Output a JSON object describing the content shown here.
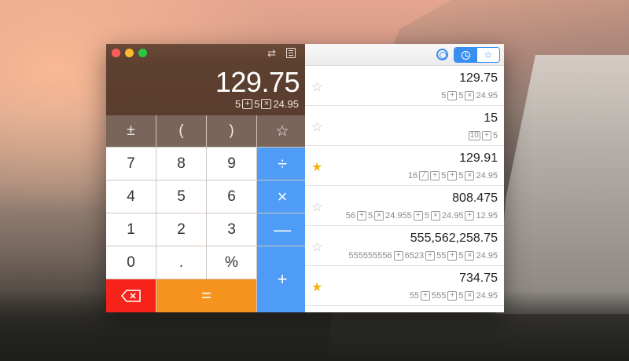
{
  "calculator": {
    "result": "129.75",
    "expression": [
      {
        "t": "num",
        "v": "5"
      },
      {
        "t": "op",
        "v": "+"
      },
      {
        "t": "num",
        "v": "5"
      },
      {
        "t": "op",
        "v": "×"
      },
      {
        "t": "num",
        "v": "24.95"
      }
    ],
    "keys": {
      "plusminus": "±",
      "lparen": "(",
      "rparen": ")",
      "star": "☆",
      "seven": "7",
      "eight": "8",
      "nine": "9",
      "divide": "÷",
      "four": "4",
      "five": "5",
      "six": "6",
      "multiply": "×",
      "one": "1",
      "two": "2",
      "three": "3",
      "minus": "—",
      "zero": "0",
      "dot": ".",
      "percent": "%",
      "plus": "+",
      "equals": "="
    }
  },
  "history": {
    "rows": [
      {
        "favorite": false,
        "result": "129.75",
        "expression": [
          {
            "t": "num",
            "v": "5"
          },
          {
            "t": "op",
            "v": "+"
          },
          {
            "t": "num",
            "v": "5"
          },
          {
            "t": "op",
            "v": "×"
          },
          {
            "t": "num",
            "v": "24.95"
          }
        ]
      },
      {
        "favorite": false,
        "result": "15",
        "expression": [
          {
            "t": "op",
            "v": "10"
          },
          {
            "t": "op",
            "v": "+"
          },
          {
            "t": "num",
            "v": "5"
          }
        ]
      },
      {
        "favorite": true,
        "result": "129.91",
        "expression": [
          {
            "t": "num",
            "v": "16"
          },
          {
            "t": "op",
            "v": "⁄"
          },
          {
            "t": "op",
            "v": "+"
          },
          {
            "t": "num",
            "v": "5"
          },
          {
            "t": "op",
            "v": "+"
          },
          {
            "t": "num",
            "v": "5"
          },
          {
            "t": "op",
            "v": "×"
          },
          {
            "t": "num",
            "v": "24.95"
          }
        ]
      },
      {
        "favorite": false,
        "result": "808.475",
        "expression": [
          {
            "t": "num",
            "v": "56"
          },
          {
            "t": "op",
            "v": "+"
          },
          {
            "t": "num",
            "v": "5"
          },
          {
            "t": "op",
            "v": "×"
          },
          {
            "t": "num",
            "v": "24.955"
          },
          {
            "t": "op",
            "v": "+"
          },
          {
            "t": "num",
            "v": "5"
          },
          {
            "t": "op",
            "v": "×"
          },
          {
            "t": "num",
            "v": "24.95"
          },
          {
            "t": "op",
            "v": "+"
          },
          {
            "t": "num",
            "v": "12.95"
          }
        ]
      },
      {
        "favorite": false,
        "result": "555,562,258.75",
        "expression": [
          {
            "t": "num",
            "v": "555555556"
          },
          {
            "t": "op",
            "v": "+"
          },
          {
            "t": "num",
            "v": "6523"
          },
          {
            "t": "op",
            "v": "+"
          },
          {
            "t": "num",
            "v": "55"
          },
          {
            "t": "op",
            "v": "+"
          },
          {
            "t": "num",
            "v": "5"
          },
          {
            "t": "op",
            "v": "×"
          },
          {
            "t": "num",
            "v": "24.95"
          }
        ]
      },
      {
        "favorite": true,
        "result": "734.75",
        "expression": [
          {
            "t": "num",
            "v": "55"
          },
          {
            "t": "op",
            "v": "+"
          },
          {
            "t": "num",
            "v": "555"
          },
          {
            "t": "op",
            "v": "+"
          },
          {
            "t": "num",
            "v": "5"
          },
          {
            "t": "op",
            "v": "×"
          },
          {
            "t": "num",
            "v": "24.95"
          }
        ]
      }
    ]
  },
  "colors": {
    "accent": "#3a8ef0",
    "op_key": "#4e9cf5",
    "equals_key": "#f6921e",
    "delete_key": "#f5231a",
    "favorite_star": "#f2b21c"
  }
}
